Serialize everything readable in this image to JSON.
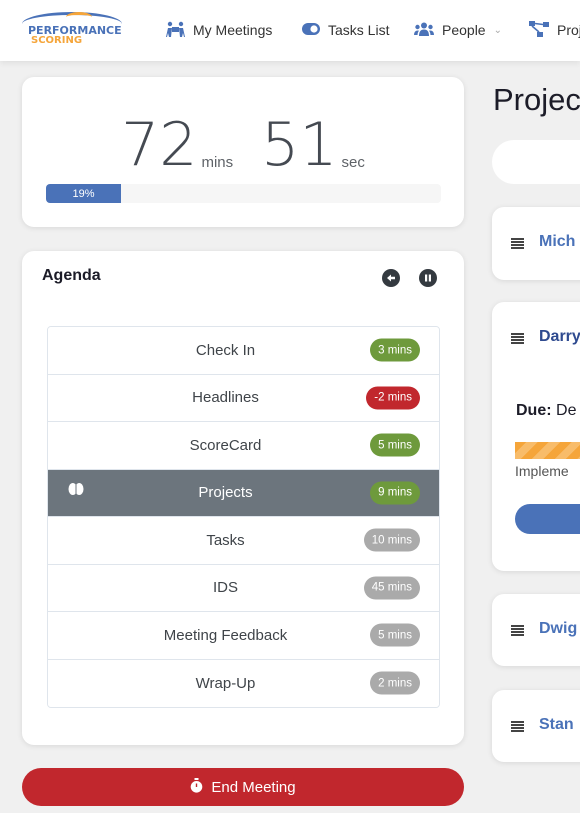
{
  "nav": {
    "logo_line1": "PERFORMANCE",
    "logo_line2": "SCORING",
    "items": [
      {
        "label": "My Meetings",
        "icon": "people-carry-icon"
      },
      {
        "label": "Tasks List",
        "icon": "toggle-icon"
      },
      {
        "label": "People",
        "icon": "users-icon",
        "dropdown": true
      },
      {
        "label": "Proj",
        "icon": "sitemap-icon"
      }
    ],
    "brand_color": "#4a72b8",
    "accent_color": "#f5a53a"
  },
  "timer": {
    "minutes": "72",
    "minutes_unit": "mins",
    "seconds": "51",
    "seconds_unit": "sec",
    "progress_percent": 19,
    "progress_label": "19%"
  },
  "agenda": {
    "title": "Agenda",
    "items": [
      {
        "label": "Check In",
        "badge": "3 mins",
        "badge_color": "#6e9a3c",
        "active": false
      },
      {
        "label": "Headlines",
        "badge": "-2 mins",
        "badge_color": "#c1272d",
        "active": false
      },
      {
        "label": "ScoreCard",
        "badge": "5 mins",
        "badge_color": "#6e9a3c",
        "active": false
      },
      {
        "label": "Projects",
        "badge": "9 mins",
        "badge_color": "#6e9a3c",
        "active": true
      },
      {
        "label": "Tasks",
        "badge": "10 mins",
        "badge_color": "#aaaaaa",
        "active": false
      },
      {
        "label": "IDS",
        "badge": "45 mins",
        "badge_color": "#aaaaaa",
        "active": false
      },
      {
        "label": "Meeting Feedback",
        "badge": "5 mins",
        "badge_color": "#aaaaaa",
        "active": false
      },
      {
        "label": "Wrap-Up",
        "badge": "2 mins",
        "badge_color": "#aaaaaa",
        "active": false
      }
    ]
  },
  "end_meeting": {
    "label": "End Meeting",
    "color": "#c1272d"
  },
  "projects": {
    "title": "Projec",
    "cards": [
      {
        "name": "Mich"
      },
      {
        "name": "Darry",
        "due_label": "Due:",
        "due_value": "De",
        "status_text": "Impleme"
      },
      {
        "name": "Dwig"
      },
      {
        "name": "Stan"
      }
    ]
  }
}
